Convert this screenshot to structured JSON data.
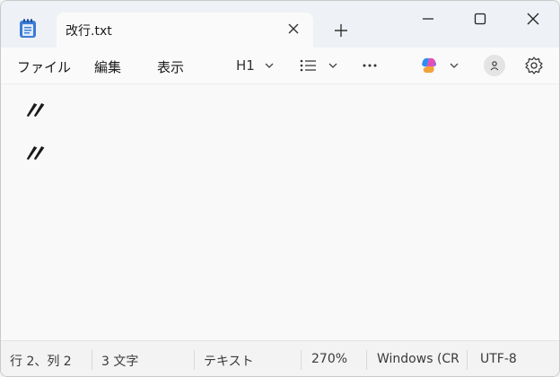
{
  "tab": {
    "title": "改行.txt"
  },
  "menu": {
    "file": "ファイル",
    "edit": "編集",
    "view": "表示"
  },
  "toolbar": {
    "heading": "H1"
  },
  "editor": {
    "lines": [
      "〃",
      "〃"
    ]
  },
  "status": {
    "position": "行 2、列 2",
    "chars": "3 文字",
    "format": "テキスト",
    "zoom": "270%",
    "line_ending": "Windows (CRLF)",
    "encoding": "UTF-8"
  }
}
